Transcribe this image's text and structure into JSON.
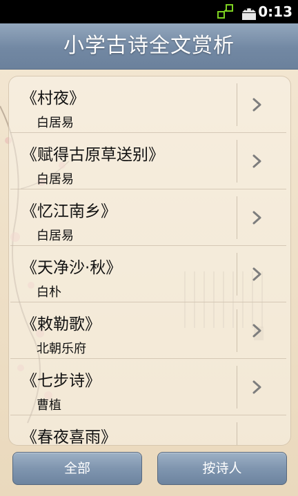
{
  "status_bar": {
    "time": "0:13",
    "icons": [
      "data-sync-icon",
      "android-icon"
    ]
  },
  "header": {
    "title": "小学古诗全文赏析"
  },
  "poems": [
    {
      "title": "《村夜》",
      "author": "白居易"
    },
    {
      "title": "《赋得古原草送别》",
      "author": "白居易"
    },
    {
      "title": "《忆江南乡》",
      "author": "白居易"
    },
    {
      "title": "《天净沙·秋》",
      "author": "白朴"
    },
    {
      "title": "《敕勒歌》",
      "author": "北朝乐府"
    },
    {
      "title": "《七步诗》",
      "author": "曹植"
    },
    {
      "title": "《春夜喜雨》",
      "author": ""
    }
  ],
  "buttons": {
    "all": "全部",
    "by_poet": "按诗人"
  },
  "colors": {
    "title_bar": "#7a8fa9",
    "button": "#7f95af",
    "background": "#efe2cc"
  }
}
